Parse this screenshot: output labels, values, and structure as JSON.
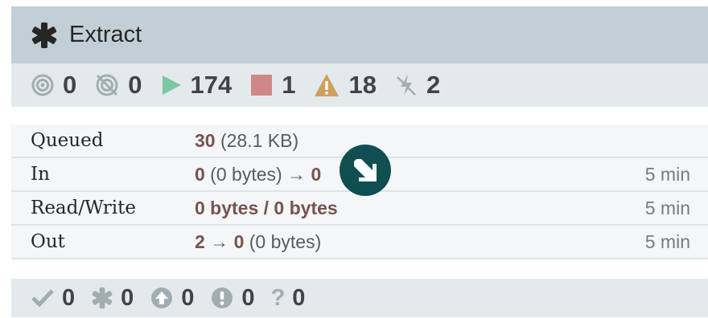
{
  "header": {
    "title": "Extract",
    "icon": "asterisk-icon"
  },
  "stats": {
    "transmitting": "0",
    "not_transmitting": "0",
    "running": "174",
    "stopped": "1",
    "invalid": "18",
    "disabled": "2"
  },
  "status_rows": [
    {
      "label": "Queued",
      "value_bold": "30",
      "value_rest": " (28.1 KB)",
      "age": ""
    },
    {
      "label": "In",
      "value_bold": "0",
      "value_rest": " (0 bytes) → ",
      "value_bold2": "0",
      "age": "5 min"
    },
    {
      "label": "Read/Write",
      "value_bold": "0 bytes / 0 bytes",
      "value_rest": "",
      "age": "5 min"
    },
    {
      "label": "Out",
      "value_bold": "2",
      "value_rest": " → ",
      "value_bold2": "0",
      "value_rest2": " (0 bytes)",
      "age": "5 min"
    }
  ],
  "footer": {
    "up_to_date": "0",
    "locally_modified": "0",
    "stale": "0",
    "sync_failure": "0",
    "unknown": "0",
    "unknown_icon_text": "?"
  },
  "colors": {
    "header_bg": "#c3cfd6",
    "stats_bg": "#e4eaec",
    "running": "#7dc7a0",
    "stopped": "#d18686",
    "invalid": "#cf9f5d",
    "value_bold": "#775351",
    "cursor": "#0f4f51"
  }
}
